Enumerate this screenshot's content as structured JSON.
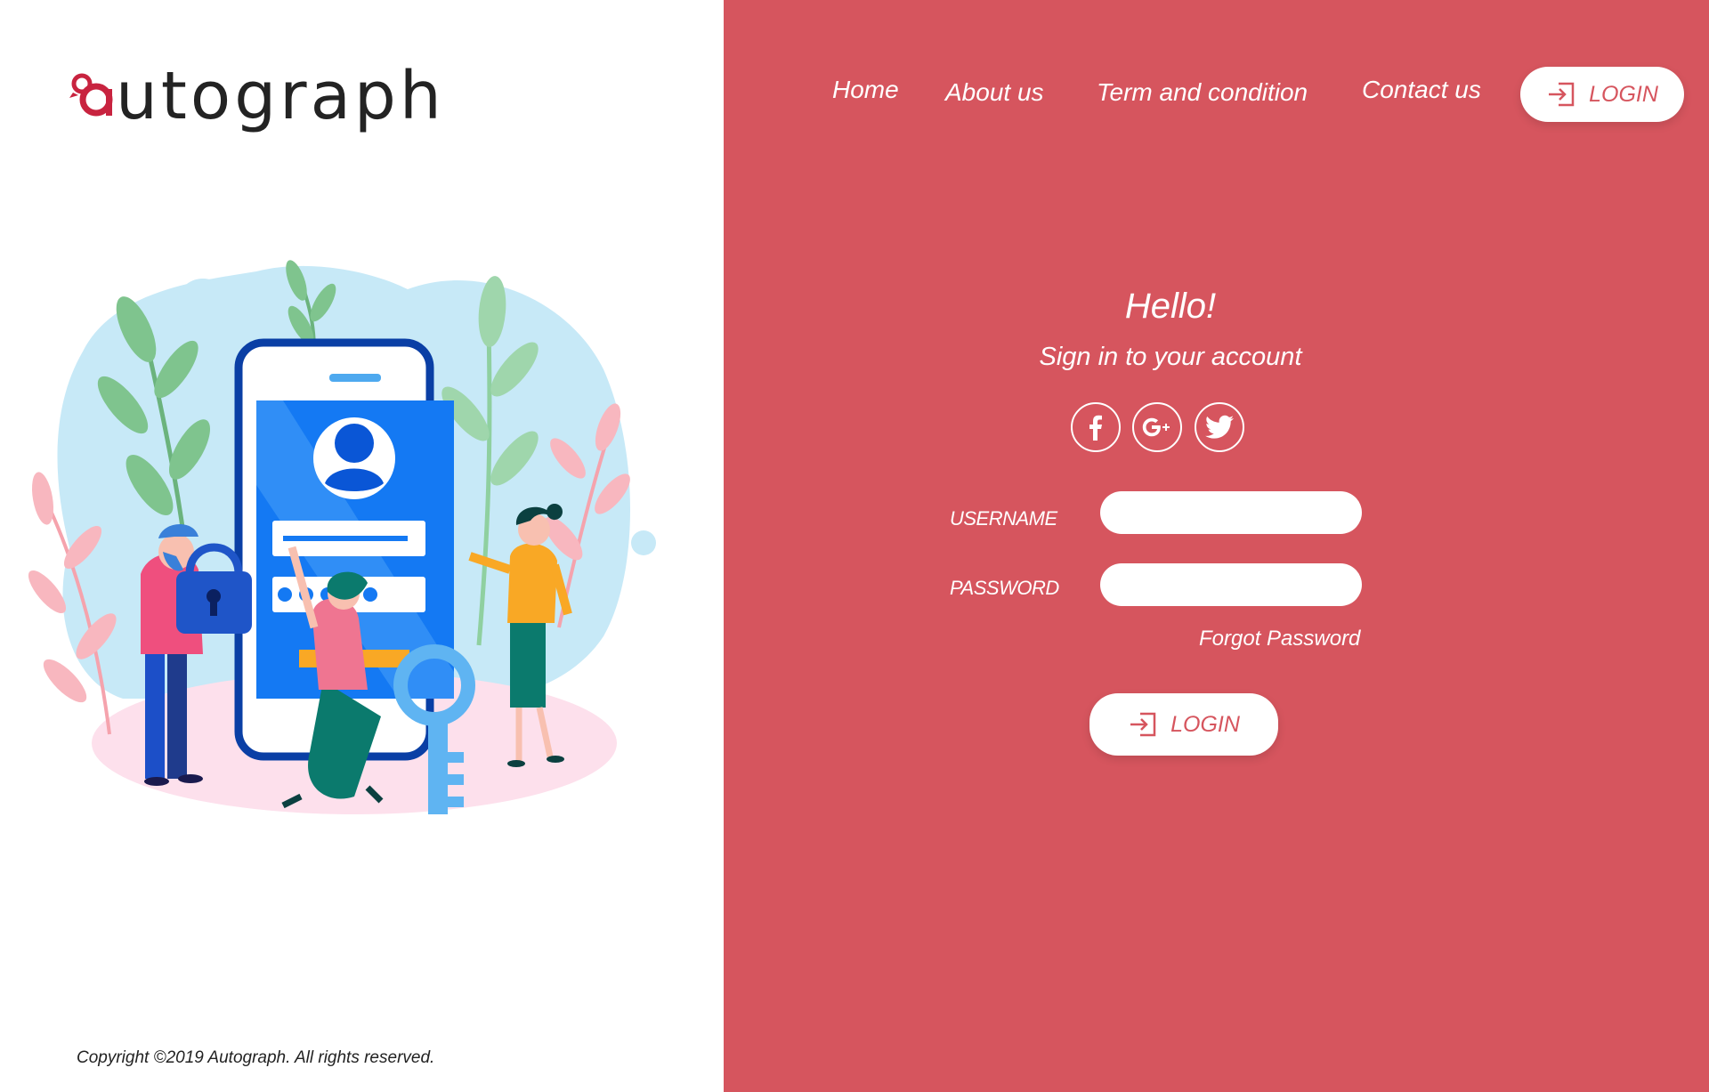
{
  "logo": {
    "text": "utograph"
  },
  "nav": {
    "items": [
      "Home",
      "About us",
      "Term and condition",
      "Contact us"
    ],
    "login_label": "LOGIN"
  },
  "login_form": {
    "title": "Hello!",
    "subtitle": "Sign in to your account",
    "social": [
      "facebook-icon",
      "google-plus-icon",
      "twitter-icon"
    ],
    "username_label": "USERNAME",
    "username_value": "",
    "password_label": "PASSWORD",
    "password_value": "",
    "forgot_label": "Forgot Password",
    "submit_label": "LOGIN"
  },
  "footer": {
    "copyright": "Copyright ©2019 Autograph. All rights reserved."
  },
  "colors": {
    "brand": "#d6555e",
    "logo_accent": "#c8233f",
    "text_dark": "#232323"
  }
}
